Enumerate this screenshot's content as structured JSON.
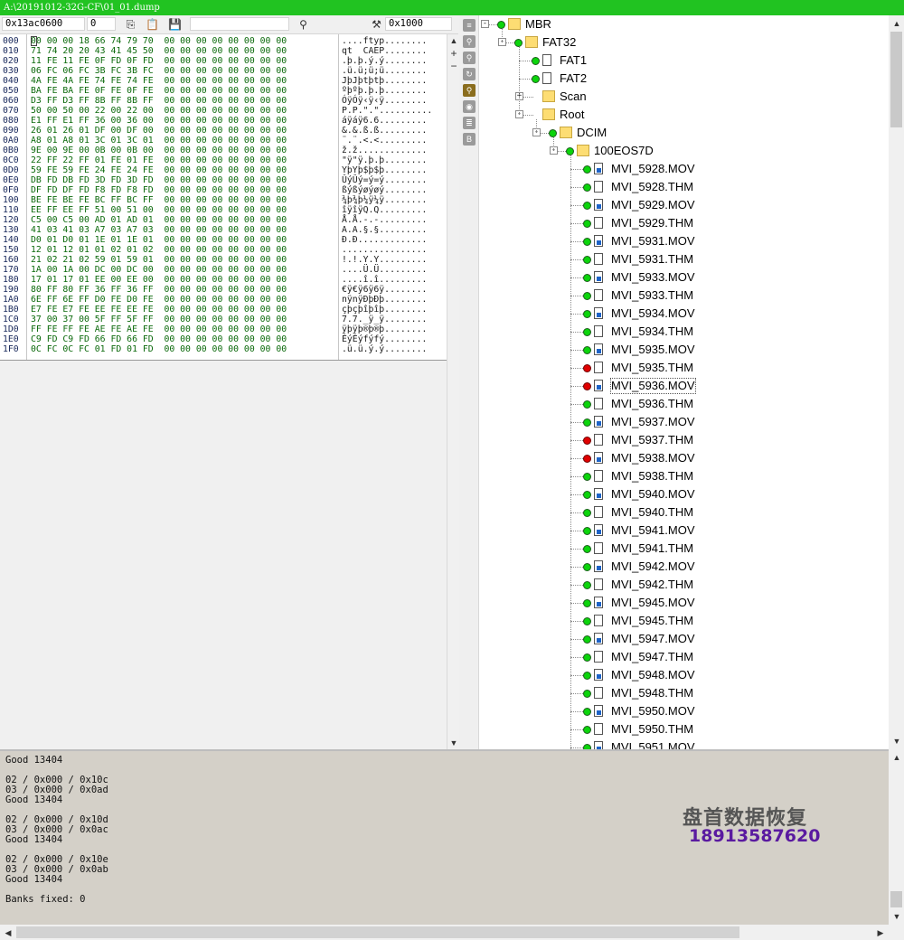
{
  "window": {
    "title": "A:\\20191012-32G-CF\\01_01.dump"
  },
  "toolbar": {
    "offset": "0x13ac0600",
    "value": "0",
    "search": "",
    "block_size": "0x1000"
  },
  "hex": {
    "rows": [
      {
        "addr": "000",
        "bytes": "00 00 00 18 66 74 79 70  00 00 00 00 00 00 00 00",
        "ascii": "....ftyp........"
      },
      {
        "addr": "010",
        "bytes": "71 74 20 20 43 41 45 50  00 00 00 00 00 00 00 00",
        "ascii": "qt  CAEP........"
      },
      {
        "addr": "020",
        "bytes": "11 FE 11 FE 0F FD 0F FD  00 00 00 00 00 00 00 00",
        "ascii": ".þ.þ.ý.ý........"
      },
      {
        "addr": "030",
        "bytes": "06 FC 06 FC 3B FC 3B FC  00 00 00 00 00 00 00 00",
        "ascii": ".ü.ü;ü;ü........"
      },
      {
        "addr": "040",
        "bytes": "4A FE 4A FE 74 FE 74 FE  00 00 00 00 00 00 00 00",
        "ascii": "JþJþtþtþ........"
      },
      {
        "addr": "050",
        "bytes": "BA FE BA FE 0F FE 0F FE  00 00 00 00 00 00 00 00",
        "ascii": "ºþºþ.þ.þ........"
      },
      {
        "addr": "060",
        "bytes": "D3 FF D3 FF 8B FF 8B FF  00 00 00 00 00 00 00 00",
        "ascii": "ÓÿÓÿ‹ÿ‹ÿ........"
      },
      {
        "addr": "070",
        "bytes": "50 00 50 00 22 00 22 00  00 00 00 00 00 00 00 00",
        "ascii": "P.P.\".\".........."
      },
      {
        "addr": "080",
        "bytes": "E1 FF E1 FF 36 00 36 00  00 00 00 00 00 00 00 00",
        "ascii": "áÿáÿ6.6........."
      },
      {
        "addr": "090",
        "bytes": "26 01 26 01 DF 00 DF 00  00 00 00 00 00 00 00 00",
        "ascii": "&.&.ß.ß........."
      },
      {
        "addr": "0A0",
        "bytes": "A8 01 A8 01 3C 01 3C 01  00 00 00 00 00 00 00 00",
        "ascii": "¨.¨.<.<........."
      },
      {
        "addr": "0B0",
        "bytes": "9E 00 9E 00 0B 00 0B 00  00 00 00 00 00 00 00 00",
        "ascii": "ž.ž............."
      },
      {
        "addr": "0C0",
        "bytes": "22 FF 22 FF 01 FE 01 FE  00 00 00 00 00 00 00 00",
        "ascii": "\"ÿ\"ÿ.þ.þ........"
      },
      {
        "addr": "0D0",
        "bytes": "59 FE 59 FE 24 FE 24 FE  00 00 00 00 00 00 00 00",
        "ascii": "YþYþ$þ$þ........"
      },
      {
        "addr": "0E0",
        "bytes": "DB FD DB FD 3D FD 3D FD  00 00 00 00 00 00 00 00",
        "ascii": "ÛýÛý=ý=ý........"
      },
      {
        "addr": "0F0",
        "bytes": "DF FD DF FD F8 FD F8 FD  00 00 00 00 00 00 00 00",
        "ascii": "ßýßýøýøý........"
      },
      {
        "addr": "100",
        "bytes": "BE FE BE FE BC FF BC FF  00 00 00 00 00 00 00 00",
        "ascii": "¾þ¾þ¼ÿ¼ÿ........"
      },
      {
        "addr": "110",
        "bytes": "EE FF EE FF 51 00 51 00  00 00 00 00 00 00 00 00",
        "ascii": "îÿîÿQ.Q........."
      },
      {
        "addr": "120",
        "bytes": "C5 00 C5 00 AD 01 AD 01  00 00 00 00 00 00 00 00",
        "ascii": "Å.Å.-.-........."
      },
      {
        "addr": "130",
        "bytes": "41 03 41 03 A7 03 A7 03  00 00 00 00 00 00 00 00",
        "ascii": "A.A.§.§........."
      },
      {
        "addr": "140",
        "bytes": "D0 01 D0 01 1E 01 1E 01  00 00 00 00 00 00 00 00",
        "ascii": "Ð.Ð............."
      },
      {
        "addr": "150",
        "bytes": "12 01 12 01 01 02 01 02  00 00 00 00 00 00 00 00",
        "ascii": "................"
      },
      {
        "addr": "160",
        "bytes": "21 02 21 02 59 01 59 01  00 00 00 00 00 00 00 00",
        "ascii": "!.!.Y.Y........."
      },
      {
        "addr": "170",
        "bytes": "1A 00 1A 00 DC 00 DC 00  00 00 00 00 00 00 00 00",
        "ascii": "....Ü.Ü........."
      },
      {
        "addr": "180",
        "bytes": "17 01 17 01 EE 00 EE 00  00 00 00 00 00 00 00 00",
        "ascii": "....î.î........."
      },
      {
        "addr": "190",
        "bytes": "80 FF 80 FF 36 FF 36 FF  00 00 00 00 00 00 00 00",
        "ascii": "€ÿ€ÿ6ÿ6ÿ........"
      },
      {
        "addr": "1A0",
        "bytes": "6E FF 6E FF D0 FE D0 FE  00 00 00 00 00 00 00 00",
        "ascii": "nÿnÿÐþÐþ........"
      },
      {
        "addr": "1B0",
        "bytes": "E7 FE E7 FE EE FE EE FE  00 00 00 00 00 00 00 00",
        "ascii": "çþçþîþîþ........"
      },
      {
        "addr": "1C0",
        "bytes": "37 00 37 00 5F FF 5F FF  00 00 00 00 00 00 00 00",
        "ascii": "7.7._ÿ_ÿ........"
      },
      {
        "addr": "1D0",
        "bytes": "FF FE FF FE AE FE AE FE  00 00 00 00 00 00 00 00",
        "ascii": "ÿþÿþ®þ®þ........"
      },
      {
        "addr": "1E0",
        "bytes": "C9 FD C9 FD 66 FD 66 FD  00 00 00 00 00 00 00 00",
        "ascii": "ÉýÉýfýfý........"
      },
      {
        "addr": "1F0",
        "bytes": "0C FC 0C FC 01 FD 01 FD  00 00 00 00 00 00 00 00",
        "ascii": ".ü.ü.ý.ý........"
      }
    ]
  },
  "tree": {
    "nodes": [
      {
        "label": "MBR",
        "type": "folder",
        "status": "green",
        "depth": 0,
        "expander": "-"
      },
      {
        "label": "FAT32",
        "type": "folder",
        "status": "green",
        "depth": 1,
        "expander": "-"
      },
      {
        "label": "FAT1",
        "type": "file",
        "status": "green",
        "depth": 2,
        "expander": ""
      },
      {
        "label": "FAT2",
        "type": "file",
        "status": "green",
        "depth": 2,
        "expander": ""
      },
      {
        "label": "Scan",
        "type": "folder",
        "status": "none",
        "depth": 2,
        "expander": "+"
      },
      {
        "label": "Root",
        "type": "folder",
        "status": "none",
        "depth": 2,
        "expander": "-"
      },
      {
        "label": "DCIM",
        "type": "folder",
        "status": "green",
        "depth": 3,
        "expander": "-"
      },
      {
        "label": "100EOS7D",
        "type": "folder",
        "status": "green",
        "depth": 4,
        "expander": "-"
      },
      {
        "label": "MVI_5928.MOV",
        "type": "mov",
        "status": "green",
        "depth": 5
      },
      {
        "label": "MVI_5928.THM",
        "type": "file",
        "status": "green",
        "depth": 5
      },
      {
        "label": "MVI_5929.MOV",
        "type": "mov",
        "status": "green",
        "depth": 5
      },
      {
        "label": "MVI_5929.THM",
        "type": "file",
        "status": "green",
        "depth": 5
      },
      {
        "label": "MVI_5931.MOV",
        "type": "mov",
        "status": "green",
        "depth": 5
      },
      {
        "label": "MVI_5931.THM",
        "type": "file",
        "status": "green",
        "depth": 5
      },
      {
        "label": "MVI_5933.MOV",
        "type": "mov",
        "status": "green",
        "depth": 5
      },
      {
        "label": "MVI_5933.THM",
        "type": "file",
        "status": "green",
        "depth": 5
      },
      {
        "label": "MVI_5934.MOV",
        "type": "mov",
        "status": "green",
        "depth": 5
      },
      {
        "label": "MVI_5934.THM",
        "type": "file",
        "status": "green",
        "depth": 5
      },
      {
        "label": "MVI_5935.MOV",
        "type": "mov",
        "status": "green",
        "depth": 5
      },
      {
        "label": "MVI_5935.THM",
        "type": "file",
        "status": "red",
        "depth": 5
      },
      {
        "label": "MVI_5936.MOV",
        "type": "mov",
        "status": "red",
        "depth": 5,
        "selected": true
      },
      {
        "label": "MVI_5936.THM",
        "type": "file",
        "status": "green",
        "depth": 5
      },
      {
        "label": "MVI_5937.MOV",
        "type": "mov",
        "status": "green",
        "depth": 5
      },
      {
        "label": "MVI_5937.THM",
        "type": "file",
        "status": "red",
        "depth": 5
      },
      {
        "label": "MVI_5938.MOV",
        "type": "mov",
        "status": "red",
        "depth": 5
      },
      {
        "label": "MVI_5938.THM",
        "type": "file",
        "status": "green",
        "depth": 5
      },
      {
        "label": "MVI_5940.MOV",
        "type": "mov",
        "status": "green",
        "depth": 5
      },
      {
        "label": "MVI_5940.THM",
        "type": "file",
        "status": "green",
        "depth": 5
      },
      {
        "label": "MVI_5941.MOV",
        "type": "mov",
        "status": "green",
        "depth": 5
      },
      {
        "label": "MVI_5941.THM",
        "type": "file",
        "status": "green",
        "depth": 5
      },
      {
        "label": "MVI_5942.MOV",
        "type": "mov",
        "status": "green",
        "depth": 5
      },
      {
        "label": "MVI_5942.THM",
        "type": "file",
        "status": "green",
        "depth": 5
      },
      {
        "label": "MVI_5945.MOV",
        "type": "mov",
        "status": "green",
        "depth": 5
      },
      {
        "label": "MVI_5945.THM",
        "type": "file",
        "status": "green",
        "depth": 5
      },
      {
        "label": "MVI_5947.MOV",
        "type": "mov",
        "status": "green",
        "depth": 5
      },
      {
        "label": "MVI_5947.THM",
        "type": "file",
        "status": "green",
        "depth": 5
      },
      {
        "label": "MVI_5948.MOV",
        "type": "mov",
        "status": "green",
        "depth": 5
      },
      {
        "label": "MVI_5948.THM",
        "type": "file",
        "status": "green",
        "depth": 5
      },
      {
        "label": "MVI_5950.MOV",
        "type": "mov",
        "status": "green",
        "depth": 5
      },
      {
        "label": "MVI_5950.THM",
        "type": "file",
        "status": "green",
        "depth": 5
      },
      {
        "label": "MVI_5951.MOV",
        "type": "mov",
        "status": "green",
        "depth": 5
      }
    ]
  },
  "log": {
    "lines": [
      "Good 13404",
      "",
      "02 / 0x000 / 0x10c",
      "03 / 0x000 / 0x0ad",
      "Good 13404",
      "",
      "02 / 0x000 / 0x10d",
      "03 / 0x000 / 0x0ac",
      "Good 13404",
      "",
      "02 / 0x000 / 0x10e",
      "03 / 0x000 / 0x0ab",
      "Good 13404",
      "",
      "Banks fixed: 0"
    ]
  },
  "watermark": {
    "name": "盘首数据恢复",
    "phone": "18913587620"
  }
}
